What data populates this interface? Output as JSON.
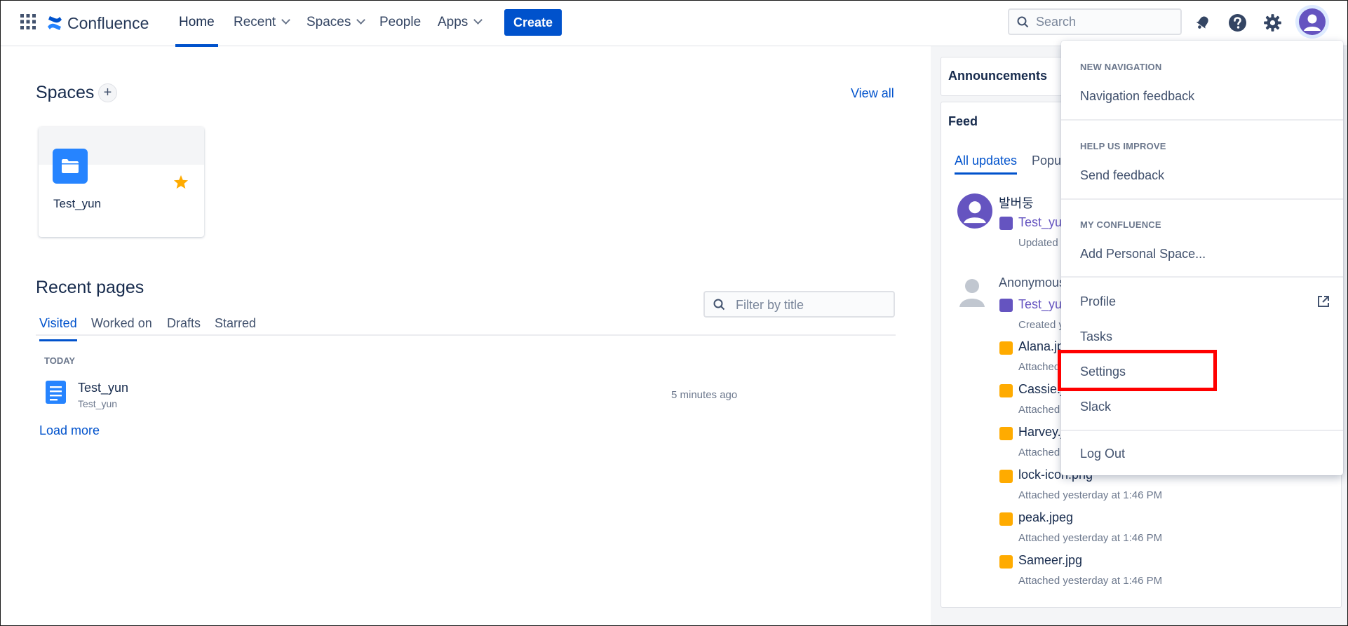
{
  "topnav": {
    "brand": "Confluence",
    "items": [
      {
        "label": "Home"
      },
      {
        "label": "Recent"
      },
      {
        "label": "Spaces"
      },
      {
        "label": "People"
      },
      {
        "label": "Apps"
      }
    ],
    "create_label": "Create",
    "search_placeholder": "Search"
  },
  "spaces": {
    "title": "Spaces",
    "view_all": "View all",
    "cards": [
      {
        "name": "Test_yun",
        "starred": true
      }
    ]
  },
  "recent": {
    "title": "Recent pages",
    "tabs": [
      "Visited",
      "Worked on",
      "Drafts",
      "Starred"
    ],
    "filter_placeholder": "Filter by title",
    "group_label": "TODAY",
    "rows": [
      {
        "title": "Test_yun",
        "space": "Test_yun",
        "time": "5 minutes ago"
      }
    ],
    "load_more": "Load more"
  },
  "announcements": {
    "title": "Announcements"
  },
  "feed": {
    "title": "Feed",
    "tabs": [
      "All updates",
      "Popul"
    ],
    "entries": [
      {
        "user": "발버둥",
        "link": "Test_yun",
        "meta": "Updated y"
      },
      {
        "user": "Anonymous",
        "link": "Test_yun",
        "meta": "Created y"
      }
    ],
    "attachments": [
      {
        "name": "Alana.jp",
        "meta": "Attached"
      },
      {
        "name": "Cassie.jp",
        "meta": "Attached"
      },
      {
        "name": "Harvey.jp",
        "meta": "Attached"
      },
      {
        "name": "lock-icon.png",
        "meta": "Attached yesterday at 1:46 PM"
      },
      {
        "name": "peak.jpeg",
        "meta": "Attached yesterday at 1:46 PM"
      },
      {
        "name": "Sameer.jpg",
        "meta": "Attached yesterday at 1:46 PM"
      }
    ]
  },
  "dropdown": {
    "sections": [
      {
        "header": "NEW NAVIGATION",
        "items": [
          "Navigation feedback"
        ]
      },
      {
        "header": "HELP US IMPROVE",
        "items": [
          "Send feedback"
        ]
      },
      {
        "header": "MY CONFLUENCE",
        "items": [
          "Add Personal Space..."
        ]
      }
    ],
    "items": [
      "Profile",
      "Tasks",
      "Settings",
      "Slack"
    ],
    "logout": "Log Out"
  },
  "colors": {
    "brand": "#0052cc",
    "highlight": "#ff0000",
    "avatar": "#6554c0",
    "star": "#ffab00"
  },
  "icons": [
    "app-switcher-icon",
    "confluence-logo-icon",
    "search-icon",
    "notification-icon",
    "help-icon",
    "gear-icon",
    "avatar",
    "star-icon",
    "page-icon",
    "external-link-icon",
    "image-icon"
  ]
}
